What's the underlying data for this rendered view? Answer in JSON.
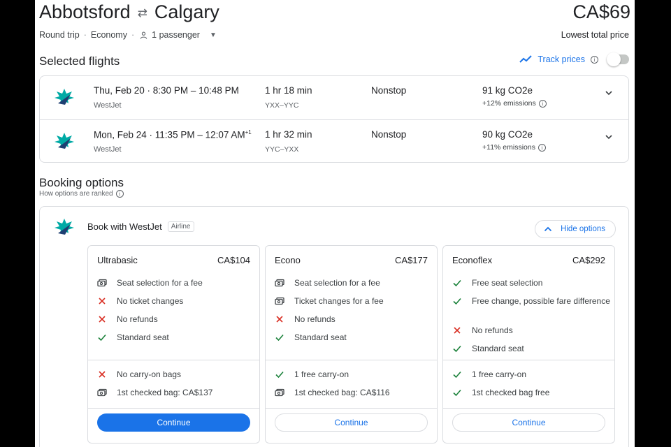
{
  "header": {
    "origin": "Abbotsford",
    "destination": "Calgary",
    "price": "CA$69",
    "trip_type": "Round trip",
    "cabin": "Economy",
    "passengers": "1 passenger",
    "price_note": "Lowest total price"
  },
  "selected": {
    "title": "Selected flights",
    "track_label": "Track prices"
  },
  "flights": [
    {
      "time": "Thu, Feb 20  ·  8:30 PM – 10:48 PM",
      "airline": "WestJet",
      "duration": "1 hr 18 min",
      "airports": "YXX–YYC",
      "stops": "Nonstop",
      "co2": "91 kg CO2e",
      "emissions": "+12% emissions"
    },
    {
      "time": "Mon, Feb 24  ·  11:35 PM – 12:07 AM",
      "time_sup": "+1",
      "airline": "WestJet",
      "duration": "1 hr 32 min",
      "airports": "YYC–YXX",
      "stops": "Nonstop",
      "co2": "90 kg CO2e",
      "emissions": "+11% emissions"
    }
  ],
  "booking": {
    "title": "Booking options",
    "subtitle": "How options are ranked",
    "book_with": "Book with WestJet",
    "badge": "Airline",
    "hide_label": "Hide options"
  },
  "fares": [
    {
      "name": "Ultrabasic",
      "price": "CA$104",
      "features": [
        {
          "icon": "money-icon",
          "text": "Seat selection for a fee"
        },
        {
          "icon": "cross-icon",
          "text": "No ticket changes"
        },
        {
          "icon": "cross-icon",
          "text": "No refunds"
        },
        {
          "icon": "check-icon",
          "text": "Standard seat"
        }
      ],
      "bags": [
        {
          "icon": "cross-icon",
          "text": "No carry-on bags"
        },
        {
          "icon": "money-icon",
          "text": "1st checked bag: CA$137"
        }
      ],
      "button": "Continue",
      "primary": true
    },
    {
      "name": "Econo",
      "price": "CA$177",
      "features": [
        {
          "icon": "money-icon",
          "text": "Seat selection for a fee"
        },
        {
          "icon": "money-icon",
          "text": "Ticket changes for a fee"
        },
        {
          "icon": "cross-icon",
          "text": "No refunds"
        },
        {
          "icon": "check-icon",
          "text": "Standard seat"
        }
      ],
      "bags": [
        {
          "icon": "check-icon",
          "text": "1 free carry-on"
        },
        {
          "icon": "money-icon",
          "text": "1st checked bag: CA$116"
        }
      ],
      "button": "Continue",
      "primary": false
    },
    {
      "name": "Econoflex",
      "price": "CA$292",
      "features": [
        {
          "icon": "check-icon",
          "text": "Free seat selection"
        },
        {
          "icon": "check-icon",
          "text": "Free change, possible fare difference"
        },
        {
          "icon": "cross-icon",
          "text": "No refunds"
        },
        {
          "icon": "check-icon",
          "text": "Standard seat"
        }
      ],
      "bags": [
        {
          "icon": "check-icon",
          "text": "1 free carry-on"
        },
        {
          "icon": "check-icon",
          "text": "1st checked bag free"
        }
      ],
      "button": "Continue",
      "primary": false
    }
  ],
  "colors": {
    "accent": "#1a73e8",
    "check": "#188038",
    "cross": "#d93025",
    "logo": "#00aaa5"
  }
}
